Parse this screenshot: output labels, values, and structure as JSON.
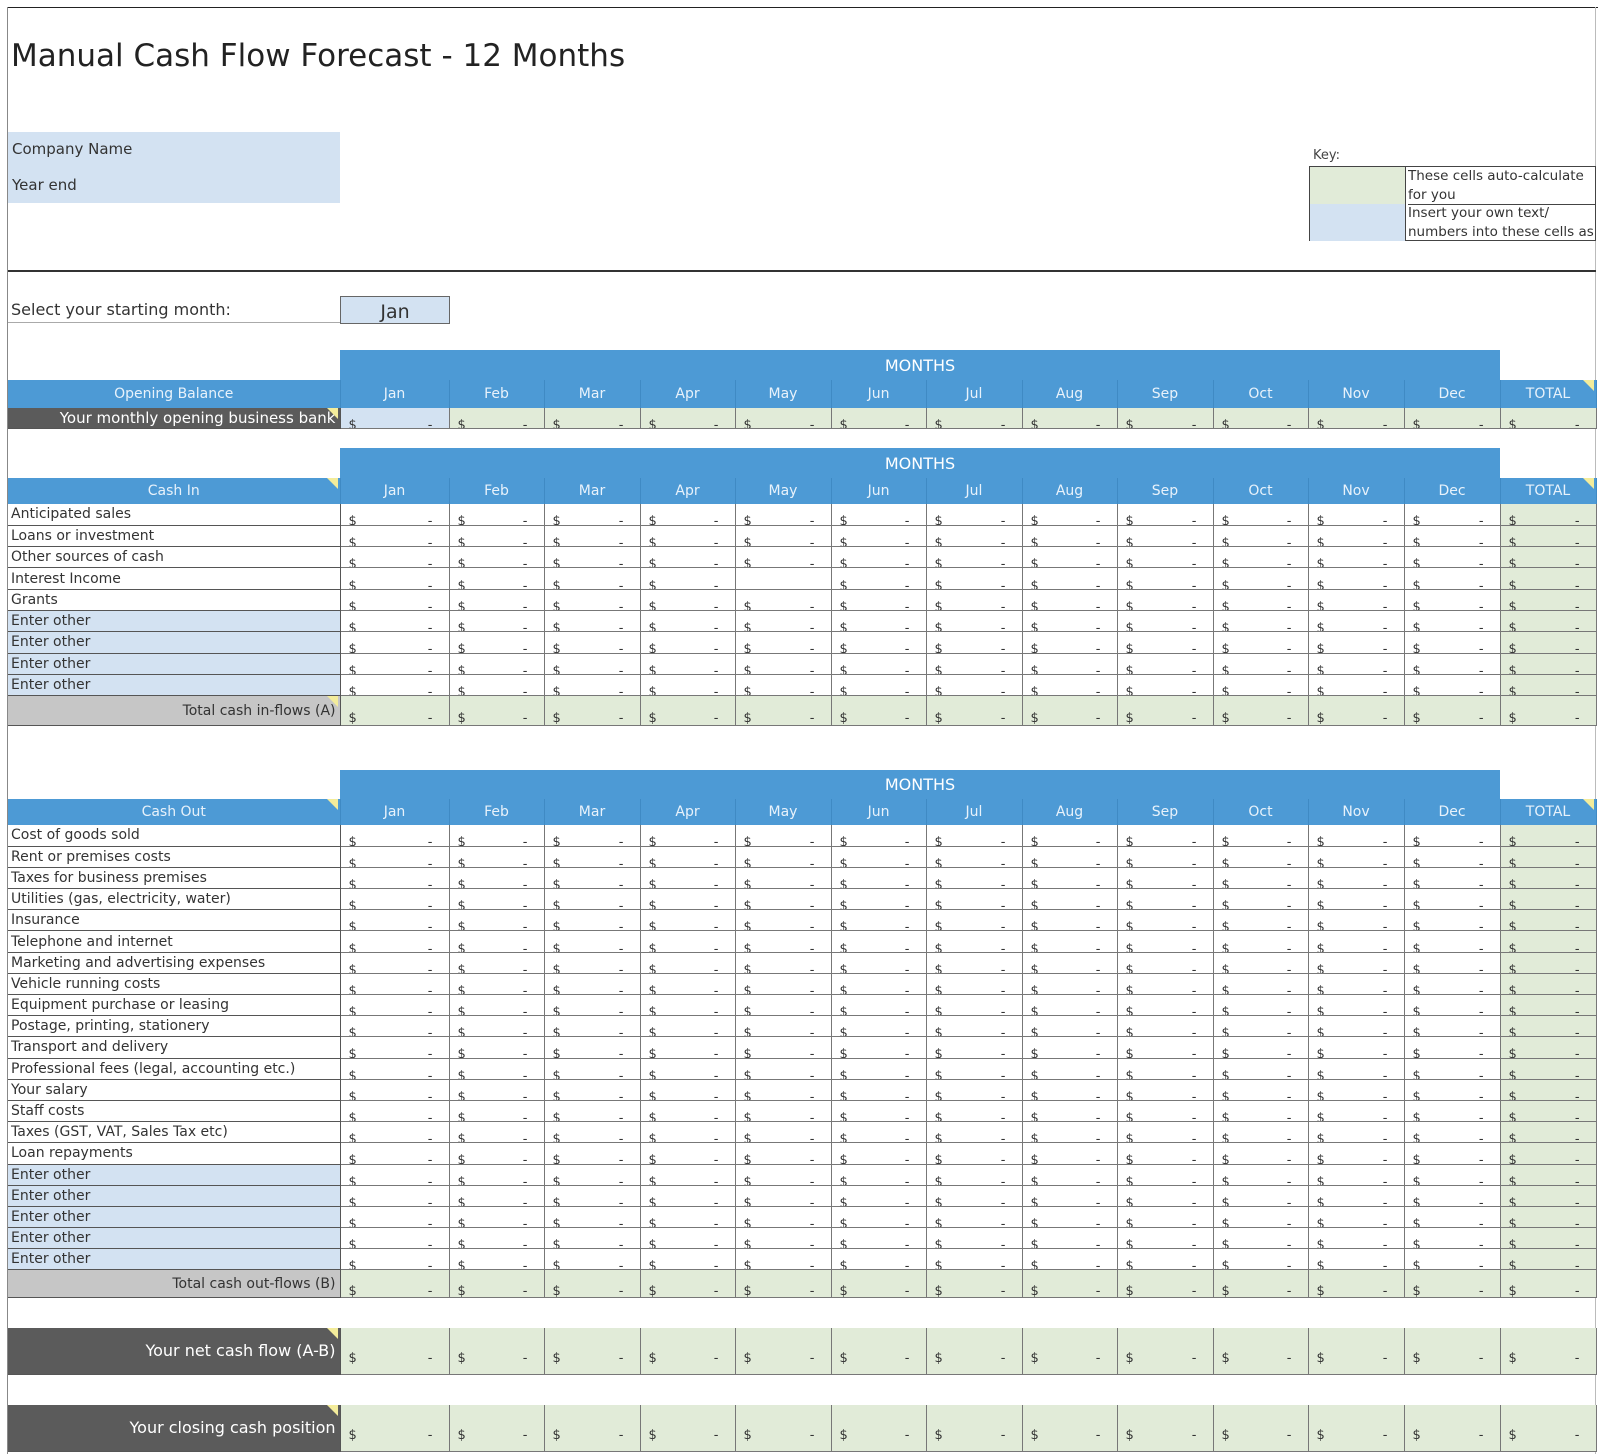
{
  "title": "Manual Cash Flow Forecast - 12 Months",
  "company": {
    "name_label": "Company Name",
    "year_end_label": "Year end"
  },
  "key": {
    "label": "Key:",
    "auto_text": "These cells auto-calculate for you",
    "insert_text": "Insert your own text/ numbers into these cells as"
  },
  "start_month": {
    "label": "Select your starting month:",
    "value": "Jan"
  },
  "months_title": "MONTHS",
  "months": [
    "Jan",
    "Feb",
    "Mar",
    "Apr",
    "May",
    "Jun",
    "Jul",
    "Aug",
    "Sep",
    "Oct",
    "Nov",
    "Dec"
  ],
  "total_label": "TOTAL",
  "currency": "$",
  "empty_value": "-",
  "colors": {
    "header_blue": "#4d9ad5",
    "input_blue": "#d3e2f2",
    "auto_green": "#e1ebd8",
    "total_grey": "#c6c6c6",
    "dark_grey": "#5b5b5b"
  },
  "opening": {
    "header": "Opening Balance",
    "row_label": "Your monthly opening business bank"
  },
  "cash_in": {
    "header": "Cash In",
    "rows": [
      "Anticipated sales",
      "Loans or investment",
      "Other sources of cash",
      "Interest Income",
      "Grants",
      "Enter other",
      "Enter other",
      "Enter other",
      "Enter other"
    ],
    "total_label": "Total cash in-flows (A)"
  },
  "cash_out": {
    "header": "Cash Out",
    "rows": [
      "Cost of goods sold",
      "Rent or premises costs",
      "Taxes for business premises",
      "Utilities (gas, electricity, water)",
      "Insurance",
      "Telephone and internet",
      "Marketing and advertising expenses",
      "Vehicle running costs",
      "Equipment purchase or leasing",
      "Postage, printing, stationery",
      "Transport and delivery",
      "Professional fees (legal, accounting etc.)",
      "Your salary",
      "Staff costs",
      "Taxes (GST, VAT, Sales Tax etc)",
      "Loan repayments",
      "Enter other",
      "Enter other",
      "Enter other",
      "Enter other",
      "Enter other"
    ],
    "total_label": "Total cash out-flows (B)"
  },
  "net_cash_flow_label": "Your net cash flow (A-B)",
  "closing_label": "Your closing cash position"
}
